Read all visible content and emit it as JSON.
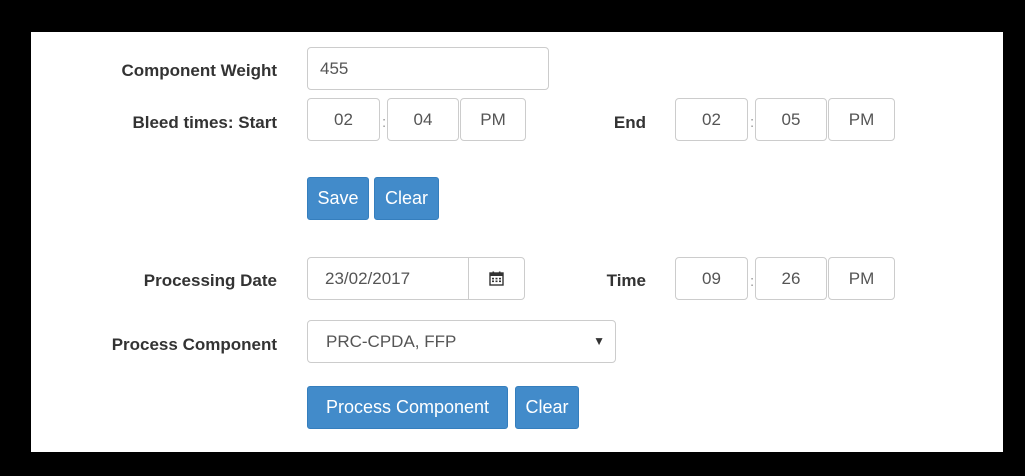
{
  "weight": {
    "label": "Component Weight",
    "value": "455"
  },
  "bleed": {
    "label_start": "Bleed times: Start",
    "start": {
      "hour": "02",
      "minute": "04",
      "ampm": "PM"
    },
    "label_end": "End",
    "end": {
      "hour": "02",
      "minute": "05",
      "ampm": "PM"
    },
    "separator": ":"
  },
  "bleed_actions": {
    "save": "Save",
    "clear": "Clear"
  },
  "processing": {
    "date_label": "Processing Date",
    "date_value": "23/02/2017",
    "time_label": "Time",
    "time": {
      "hour": "09",
      "minute": "26",
      "ampm": "PM"
    },
    "separator": ":"
  },
  "process_component": {
    "label": "Process Component",
    "selected": "PRC-CPDA, FFP"
  },
  "process_actions": {
    "process": "Process Component",
    "clear": "Clear"
  }
}
